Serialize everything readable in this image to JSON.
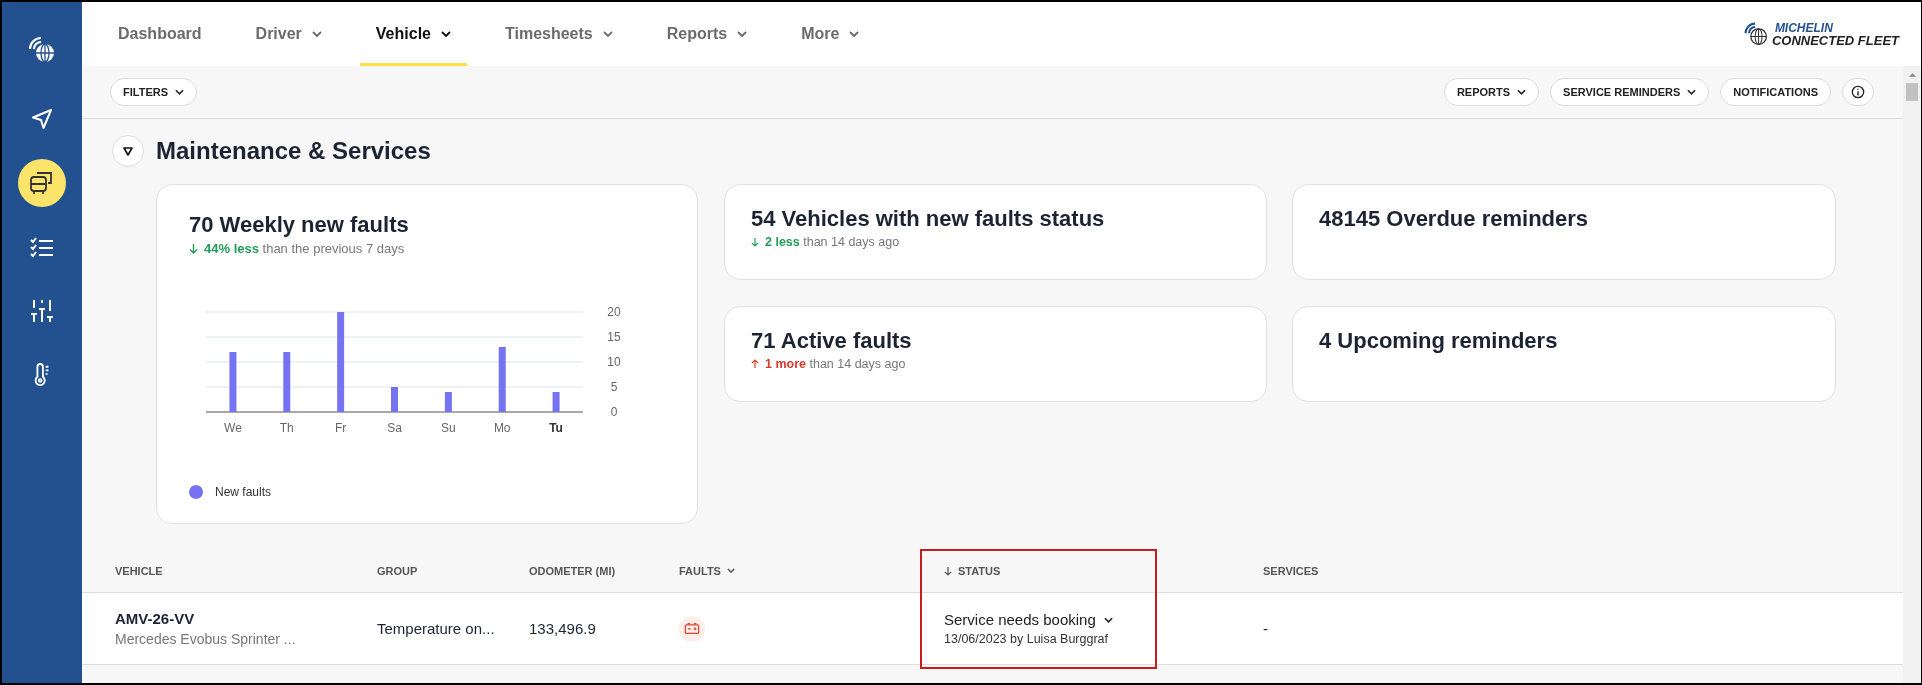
{
  "sidebar": {
    "items": [
      {
        "kind": "navigate",
        "selected": false
      },
      {
        "kind": "vehicles",
        "selected": true
      },
      {
        "kind": "checklist",
        "selected": false
      },
      {
        "kind": "sliders",
        "selected": false
      },
      {
        "kind": "temperature",
        "selected": false
      }
    ]
  },
  "tabs": [
    {
      "label": "Dashboard",
      "selected": false,
      "has_menu": false
    },
    {
      "label": "Driver",
      "selected": false,
      "has_menu": true
    },
    {
      "label": "Vehicle",
      "selected": true,
      "has_menu": true
    },
    {
      "label": "Timesheets",
      "selected": false,
      "has_menu": true
    },
    {
      "label": "Reports",
      "selected": false,
      "has_menu": true
    },
    {
      "label": "More",
      "selected": false,
      "has_menu": true
    }
  ],
  "logo": {
    "line_1": "MICHELIN",
    "line_2": "CONNECTED FLEET"
  },
  "toolbar": {
    "left": [
      {
        "label": "FILTERS",
        "has_menu": true
      }
    ],
    "right": [
      {
        "label": "REPORTS",
        "has_menu": true
      },
      {
        "label": "SERVICE REMINDERS",
        "has_menu": true
      },
      {
        "label": "NOTIFICATIONS",
        "has_menu": false
      }
    ]
  },
  "section": {
    "title": "Maintenance & Services",
    "expanded": true
  },
  "chart_card": {
    "title": "70 Weekly new faults",
    "trend": {
      "increase": false,
      "amount": "44% less",
      "rest": "than the previous 7 days"
    },
    "chart_data": {
      "type": "bar",
      "grid": true,
      "categories": [
        "We",
        "Th",
        "Fr",
        "Sa",
        "Su",
        "Mo",
        "Tu"
      ],
      "series": [
        {
          "name": "New faults",
          "color": "#7673f2",
          "values": [
            12,
            12,
            20,
            5,
            4,
            13,
            4
          ]
        }
      ],
      "ylim": [
        0,
        20
      ],
      "yticks": [
        0,
        5,
        10,
        15,
        20
      ]
    }
  },
  "stat_cards": [
    {
      "title": "54 Vehicles with new faults status",
      "trend": {
        "increase": false,
        "amount": "2 less",
        "rest": "than 14 days ago"
      }
    },
    {
      "title": "48145 Overdue reminders"
    },
    {
      "title": "71 Active faults",
      "trend": {
        "increase": true,
        "amount": "1 more",
        "rest": "than 14 days ago"
      }
    },
    {
      "title": "4 Upcoming reminders"
    }
  ],
  "table": {
    "columns": [
      {
        "label": "VEHICLE",
        "has_menu": false,
        "sorted": false,
        "highlighted": false
      },
      {
        "label": "GROUP",
        "has_menu": false,
        "sorted": false,
        "highlighted": false
      },
      {
        "label": "ODOMETER (MI)",
        "has_menu": false,
        "sorted": false,
        "highlighted": false
      },
      {
        "label": "FAULTS",
        "has_menu": true,
        "sorted": false,
        "highlighted": false
      },
      {
        "label": "STATUS",
        "has_menu": false,
        "sorted": true,
        "highlighted": true
      },
      {
        "label": "SERVICES",
        "has_menu": false,
        "sorted": false,
        "highlighted": false
      }
    ],
    "rows": [
      {
        "vehicle": "AMV-26-VV",
        "model": "Mercedes Evobus Sprinter ...",
        "group": "Temperature on...",
        "odometer": "133,496.9",
        "has_fault": true,
        "status": "Service needs booking",
        "status_detail": "13/06/2023 by Luisa Burggraf",
        "services": "-"
      }
    ]
  }
}
